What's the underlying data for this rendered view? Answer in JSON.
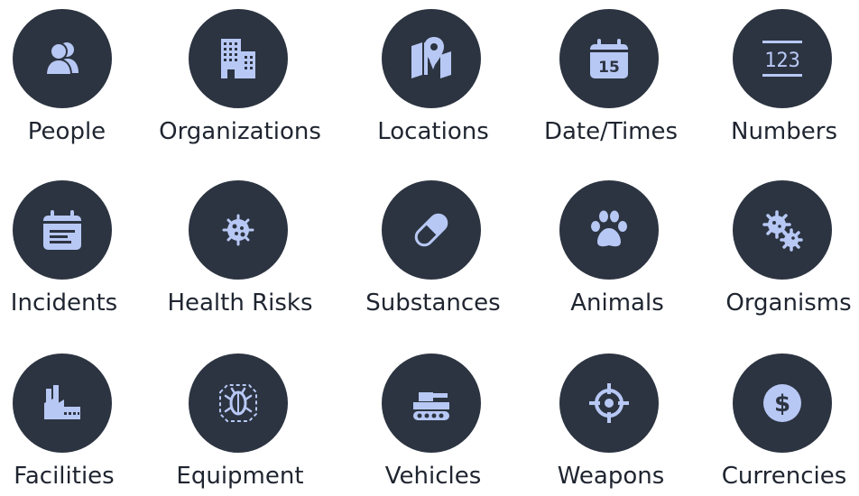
{
  "colors": {
    "circle": "#2c3441",
    "icon": "#b8c8f5",
    "label": "#1f2530"
  },
  "categories": [
    {
      "label": "People",
      "icon": "people-icon"
    },
    {
      "label": "Organizations",
      "icon": "building-icon"
    },
    {
      "label": "Locations",
      "icon": "map-pin-icon"
    },
    {
      "label": "Date/Times",
      "icon": "calendar-icon"
    },
    {
      "label": "Numbers",
      "icon": "numbers-icon"
    },
    {
      "label": "Incidents",
      "icon": "incident-calendar-icon"
    },
    {
      "label": "Health Risks",
      "icon": "virus-icon"
    },
    {
      "label": "Substances",
      "icon": "pill-icon"
    },
    {
      "label": "Animals",
      "icon": "paw-icon"
    },
    {
      "label": "Organisms",
      "icon": "gears-icon"
    },
    {
      "label": "Facilities",
      "icon": "factory-icon"
    },
    {
      "label": "Equipment",
      "icon": "bug-frame-icon"
    },
    {
      "label": "Vehicles",
      "icon": "tank-icon"
    },
    {
      "label": "Weapons",
      "icon": "crosshair-icon"
    },
    {
      "label": "Currencies",
      "icon": "dollar-coin-icon"
    }
  ],
  "icon_text": {
    "calendar_day": "15",
    "numbers": "123",
    "currency_symbol": "$"
  }
}
